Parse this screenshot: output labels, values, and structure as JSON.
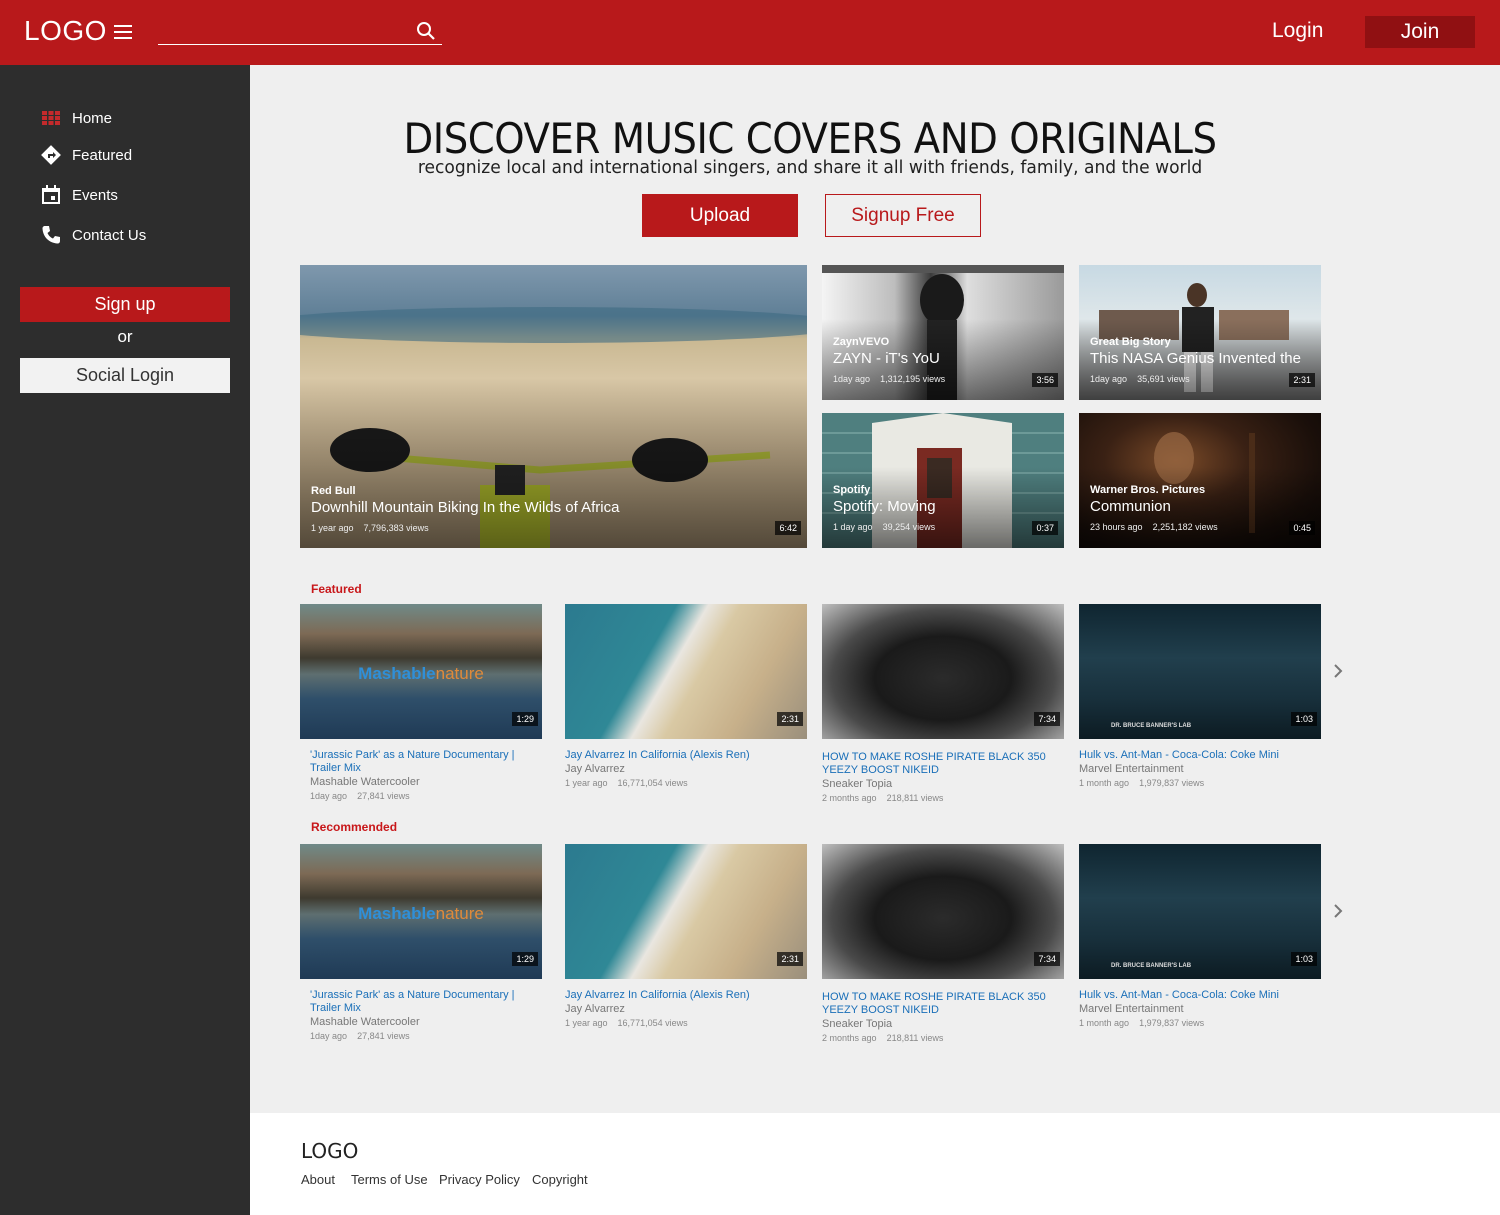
{
  "header": {
    "logo": "LOGO",
    "search_placeholder": "",
    "login_label": "Login",
    "join_label": "Join"
  },
  "sidebar": {
    "items": [
      {
        "label": "Home",
        "icon": "grid-icon"
      },
      {
        "label": "Featured",
        "icon": "direction-sign-icon"
      },
      {
        "label": "Events",
        "icon": "calendar-icon"
      },
      {
        "label": "Contact Us",
        "icon": "phone-icon"
      }
    ],
    "signup_label": "Sign up",
    "or_label": "or",
    "social_login_label": "Social Login"
  },
  "hero": {
    "title": "DISCOVER MUSIC COVERS AND ORIGINALS",
    "subtitle": "recognize local and international singers, and share it all with friends, family, and the world",
    "upload_label": "Upload",
    "signup_free_label": "Signup Free"
  },
  "tiles": [
    {
      "channel": "Red Bull",
      "title": "Downhill Mountain Biking In the Wilds of Africa",
      "age": "1 year ago",
      "views": "7,796,383 views",
      "duration": "6:42"
    },
    {
      "channel": "ZaynVEVO",
      "title": "ZAYN - iT's YoU",
      "age": "1day ago",
      "views": "1,312,195 views",
      "duration": "3:56"
    },
    {
      "channel": "Great Big Story",
      "title": "This NASA Genius Invented the",
      "age": "1day ago",
      "views": "35,691 views",
      "duration": "2:31"
    },
    {
      "channel": "Spotify",
      "title": "Spotify: Moving",
      "age": "1 day ago",
      "views": "39,254 views",
      "duration": "0:37"
    },
    {
      "channel": "Warner Bros. Pictures",
      "title": "Communion",
      "age": "23 hours ago",
      "views": "2,251,182 views",
      "duration": "0:45"
    }
  ],
  "featured": {
    "label": "Featured",
    "cards": [
      {
        "title": "'Jurassic Park' as a Nature Documentary | Trailer Mix",
        "channel": "Mashable Watercooler",
        "age": "1day ago",
        "views": "27,841 views",
        "duration": "1:29"
      },
      {
        "title": "Jay Alvarrez In California (Alexis Ren)",
        "channel": "Jay Alvarrez",
        "age": "1 year ago",
        "views": "16,771,054 views",
        "duration": "2:31"
      },
      {
        "title": "HOW TO MAKE ROSHE PIRATE BLACK 350 YEEZY BOOST NIKEID",
        "channel": "Sneaker Topia",
        "age": "2 months ago",
        "views": "218,811 views",
        "duration": "7:34"
      },
      {
        "title": "Hulk vs. Ant-Man - Coca-Cola: Coke Mini",
        "channel": "Marvel Entertainment",
        "age": "1 month ago",
        "views": "1,979,837 views",
        "duration": "1:03"
      }
    ]
  },
  "recommended": {
    "label": "Recommended",
    "cards": [
      {
        "title": "'Jurassic Park' as a Nature Documentary | Trailer Mix",
        "channel": "Mashable Watercooler",
        "age": "1day ago",
        "views": "27,841 views",
        "duration": "1:29"
      },
      {
        "title": "Jay Alvarrez In California (Alexis Ren)",
        "channel": "Jay Alvarrez",
        "age": "1 year ago",
        "views": "16,771,054 views",
        "duration": "2:31"
      },
      {
        "title": "HOW TO MAKE ROSHE PIRATE BLACK 350 YEEZY BOOST NIKEID",
        "channel": "Sneaker Topia",
        "age": "2 months ago",
        "views": "218,811 views",
        "duration": "7:34"
      },
      {
        "title": "Hulk vs. Ant-Man - Coca-Cola: Coke Mini",
        "channel": "Marvel Entertainment",
        "age": "1 month ago",
        "views": "1,979,837 views",
        "duration": "1:03"
      }
    ]
  },
  "thumb_text": {
    "mashable_a": "Mashable",
    "mashable_b": "nature",
    "lab": "DR. BRUCE BANNER'S LAB"
  },
  "footer": {
    "logo": "LOGO",
    "links": [
      "About",
      "Terms of Use",
      "Privacy Policy",
      "Copyright"
    ]
  },
  "colors": {
    "brand_red": "#b8191b",
    "dark_red": "#901012",
    "sidebar_bg": "#2d2d2d",
    "link_blue": "#1a6fb8"
  }
}
